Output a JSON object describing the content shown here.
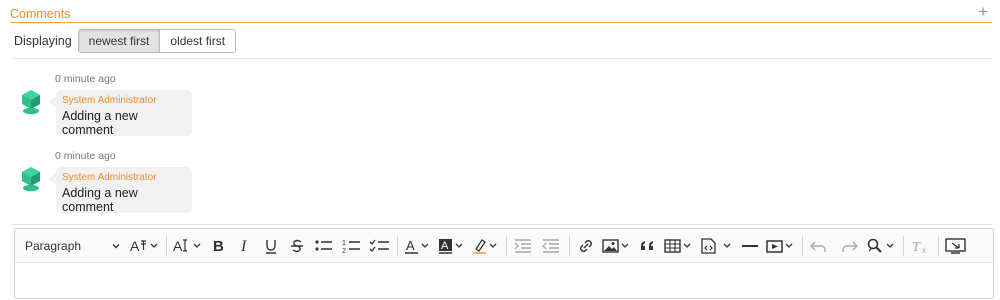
{
  "section": {
    "title": "Comments",
    "add_symbol": "+"
  },
  "display": {
    "label": "Displaying",
    "options": [
      {
        "label": "newest first",
        "active": true
      },
      {
        "label": "oldest first",
        "active": false
      }
    ]
  },
  "comments": [
    {
      "time": "0 minute ago",
      "author": "System Administrator",
      "text": "Adding a new comment"
    },
    {
      "time": "0 minute ago",
      "author": "System Administrator",
      "text": "Adding a new comment"
    }
  ],
  "editor": {
    "paragraph_label": "Paragraph",
    "toolbar_icons": [
      "font-size-icon",
      "font-family-icon",
      "bold-icon",
      "italic-icon",
      "underline-icon",
      "strikethrough-icon",
      "bulleted-list-icon",
      "numbered-list-icon",
      "todo-list-icon",
      "font-color-icon",
      "background-color-icon",
      "highlight-icon",
      "indent-icon",
      "outdent-icon",
      "link-icon",
      "image-icon",
      "blockquote-icon",
      "table-icon",
      "html-embed-icon",
      "horizontal-line-icon",
      "media-embed-icon",
      "undo-icon",
      "redo-icon",
      "find-replace-icon",
      "remove-format-icon",
      "source-editing-icon"
    ]
  },
  "colors": {
    "accent": "#ee8d2b",
    "accent_line": "#f0a04b",
    "bubble": "#f1f1f1",
    "avatar": "#2fbf8a"
  }
}
